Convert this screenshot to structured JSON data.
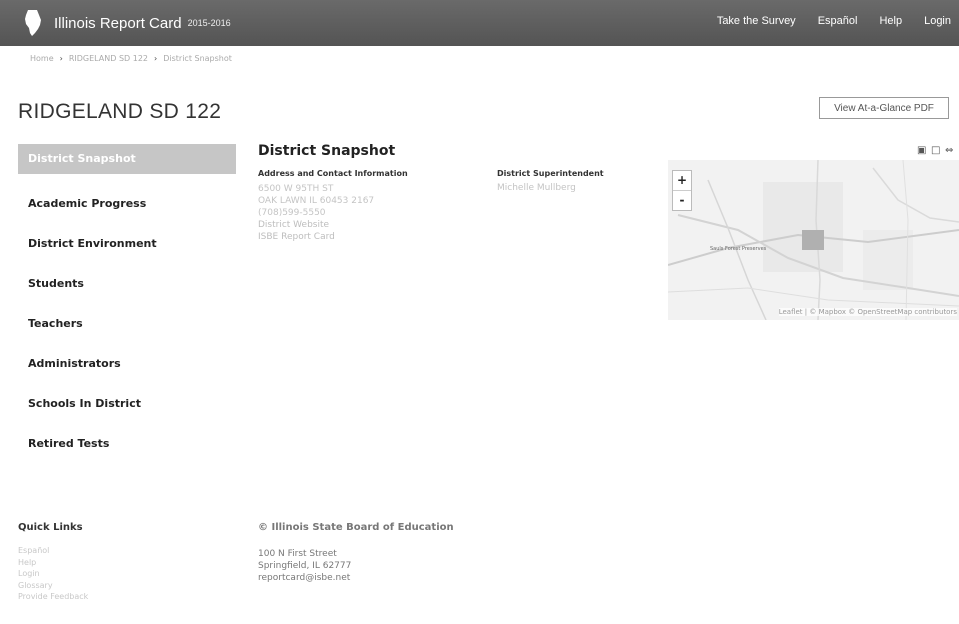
{
  "header": {
    "brand": "Illinois Report Card",
    "years": "2015-2016",
    "nav": [
      "Take the Survey",
      "Español",
      "Help",
      "Login"
    ]
  },
  "breadcrumb": [
    "Home",
    "RIDGELAND SD 122",
    "District Snapshot"
  ],
  "page_title": "RIDGELAND SD 122",
  "pdf_button": "View At-a-Glance PDF",
  "sidebar": {
    "items": [
      {
        "label": "District Snapshot",
        "active": true
      },
      {
        "label": "Academic Progress"
      },
      {
        "label": "District Environment"
      },
      {
        "label": "Students"
      },
      {
        "label": "Teachers"
      },
      {
        "label": "Administrators"
      },
      {
        "label": "Schools In District"
      },
      {
        "label": "Retired Tests"
      }
    ]
  },
  "snapshot": {
    "title": "District Snapshot",
    "address_heading": "Address and Contact Information",
    "address_lines": [
      "6500 W 95TH ST",
      "OAK LAWN IL 60453 2167",
      "(708)599-5550"
    ],
    "links": [
      "District Website",
      "ISBE Report Card"
    ],
    "superintendent_heading": "District Superintendent",
    "superintendent_name": "Michelle Mullberg"
  },
  "map": {
    "zoom_in": "+",
    "zoom_out": "-",
    "place_label": "Sauls Forest Preserves",
    "attribution": "Leaflet | © Mapbox © OpenStreetMap contributors",
    "marker_color": "#b0b0b0"
  },
  "footer": {
    "quick_links_title": "Quick Links",
    "quick_links": [
      "Español",
      "Help",
      "Login",
      "Glossary",
      "Provide Feedback"
    ],
    "isbe_title": "© Illinois State Board of Education",
    "isbe_address": [
      "100 N First Street",
      "Springfield, IL 62777",
      "reportcard@isbe.net"
    ]
  }
}
